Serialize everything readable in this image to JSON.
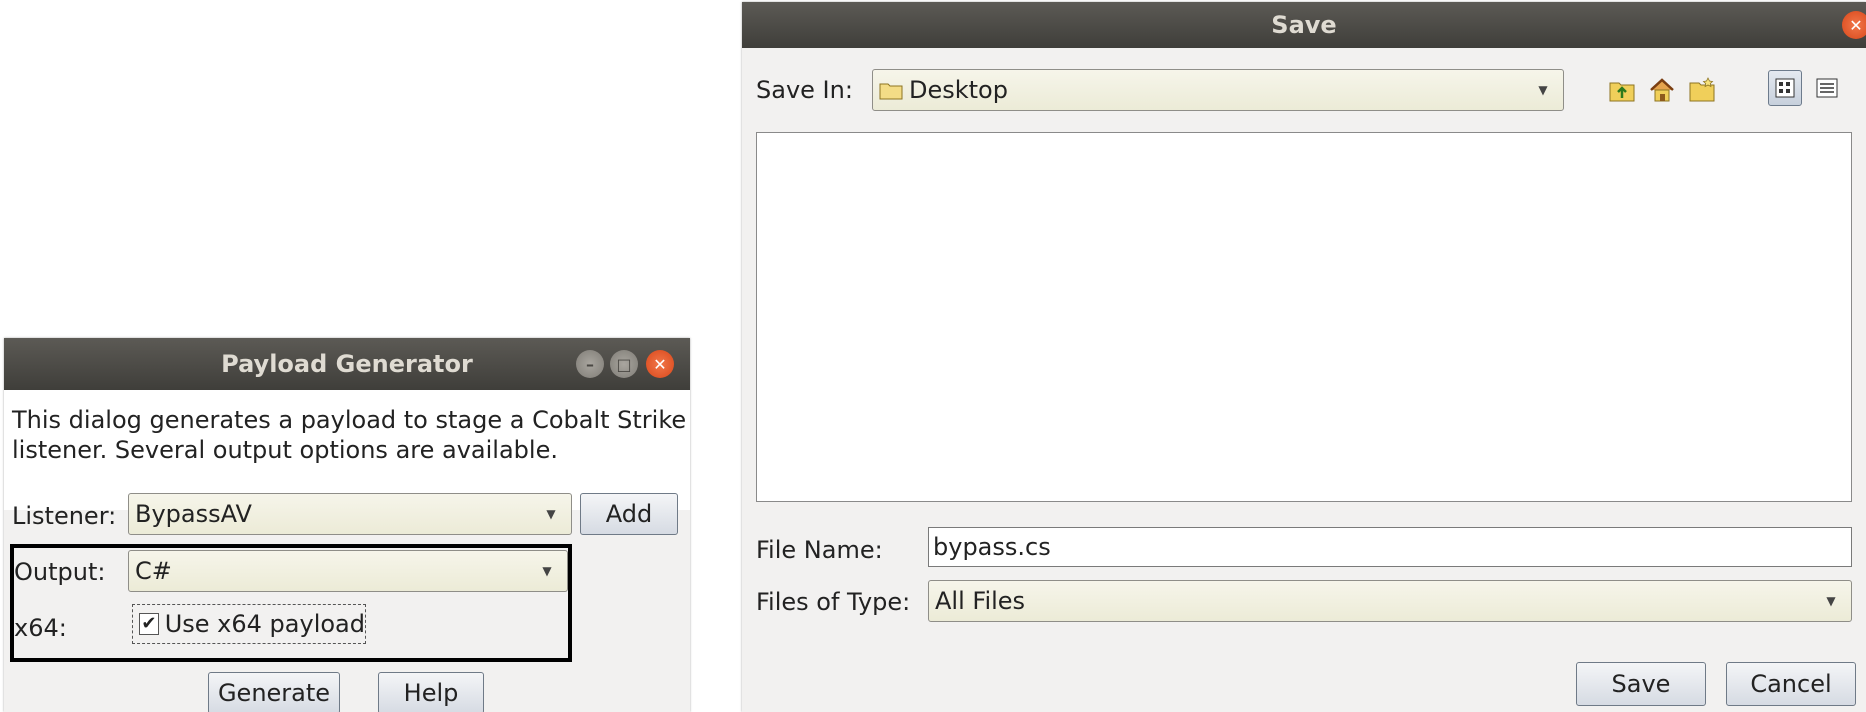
{
  "payload_generator": {
    "title": "Payload Generator",
    "description_line1": "This dialog generates a payload to stage a Cobalt Strike",
    "description_line2": "listener. Several output options are available.",
    "listener_label": "Listener:",
    "listener_value": "BypassAV",
    "add_label": "Add",
    "output_label": "Output:",
    "output_value": "C#",
    "x64_label": "x64:",
    "x64_checkbox_label": "Use x64 payload",
    "x64_checked": true,
    "generate_label": "Generate",
    "help_label": "Help"
  },
  "save_dialog": {
    "title": "Save",
    "save_in_label": "Save In:",
    "save_in_value": "Desktop",
    "file_name_label": "File Name:",
    "file_name_value": "bypass.cs",
    "files_of_type_label": "Files of Type:",
    "files_of_type_value": "All Files",
    "save_label": "Save",
    "cancel_label": "Cancel",
    "toolbar_icons": [
      "up-folder-icon",
      "home-icon",
      "new-folder-icon",
      "list-view-icon",
      "details-view-icon"
    ]
  },
  "colors": {
    "titlebar": "#4e4c47",
    "close_button": "#e55b2b",
    "highlight_box": "#000000",
    "combo_bg": "#efeedb",
    "folder_icon": "#e8c04a"
  }
}
